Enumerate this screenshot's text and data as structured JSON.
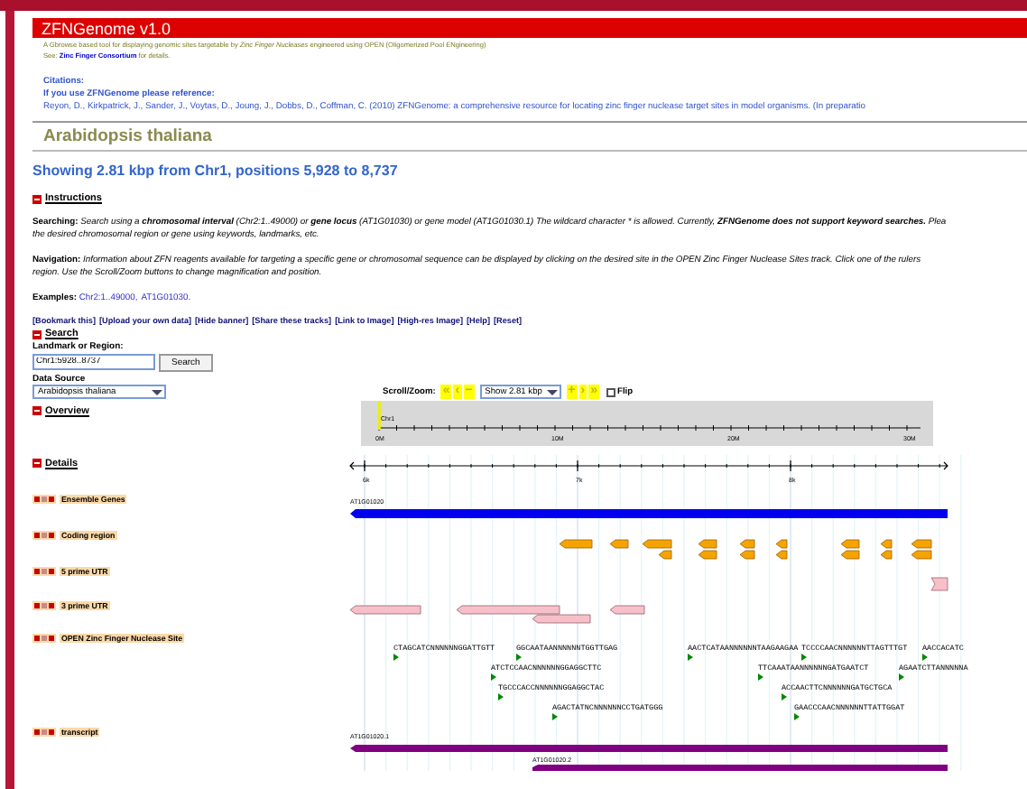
{
  "header": {
    "title": "ZFNGenome v1.0",
    "tagline": "A Gbrowse based tool for displaying genomic sites targetable by *Zinc Finger Nucleases* engineered using OPEN (Oligomerized Pool ENgineering)",
    "see_prefix": "See:",
    "see_link": "Zinc Finger Consortium",
    "see_suffix": "for details."
  },
  "citations": {
    "heading": "Citations:",
    "intro": "If you use ZFNGenome please reference:",
    "reference": "Reyon, D., Kirkpatrick, J., Sander, J., Voytas, D., Joung, J., Dobbs, D., Coffman, C. (2010) ZFNGenome: a comprehensive resource for locating zinc finger nuclease target sites in model organisms. (In preparatio"
  },
  "organism": "Arabidopsis thaliana",
  "showing": "Showing 2.81 kbp from Chr1, positions 5,928 to 8,737",
  "instructions": {
    "heading": "Instructions",
    "expanded": true,
    "paragraphs": [
      {
        "label": "Searching:",
        "segments": [
          {
            "text": "Search using a ",
            "bold": false
          },
          {
            "text": "chromosomal interval",
            "bold": true
          },
          {
            "text": " (Chr2:1..49000) or ",
            "bold": false
          },
          {
            "text": "gene locus",
            "bold": true
          },
          {
            "text": " (AT1G01030) or gene model (AT1G01030.1) The wildcard character * is allowed. Currently, ",
            "bold": false
          },
          {
            "text": "ZFNGenome does not support keyword searches.",
            "bold": true
          },
          {
            "text": " Plea\nthe desired chromosomal region or gene using keywords, landmarks, etc.",
            "bold": false
          }
        ]
      },
      {
        "label": "Navigation:",
        "segments": [
          {
            "text": "Information about ZFN reagents available for targeting a specific gene or chromosomal sequence can be displayed by clicking on the desired site in the OPEN Zinc Finger Nuclease Sites track. Click one of the rulers\nregion. Use the Scroll/Zoom buttons to change magnification and position.",
            "bold": false
          }
        ]
      }
    ],
    "examples_label": "Examples:",
    "examples": [
      "Chr2:1..49000,",
      "AT1G01030."
    ]
  },
  "links": [
    "[Bookmark this]",
    "[Upload your own data]",
    "[Hide banner]",
    "[Share these tracks]",
    "[Link to Image]",
    "[High-res Image]",
    "[Help]",
    "[Reset]"
  ],
  "search": {
    "heading": "Search",
    "expanded": true,
    "landmark_label": "Landmark or Region:",
    "landmark_value": "Chr1:5928..8737",
    "button": "Search",
    "source_label": "Data Source",
    "source_value": "Arabidopsis thaliana"
  },
  "scroll_zoom": {
    "label": "Scroll/Zoom:",
    "buttons_left": [
      "«",
      "‹",
      "−"
    ],
    "zoom_value": "Show 2.81 kbp",
    "buttons_right": [
      "+",
      "›",
      "»"
    ],
    "flip_label": "Flip",
    "flip_checked": false
  },
  "overview": {
    "heading": "Overview",
    "expanded": true,
    "chromosome": "Chr1",
    "ticks": [
      "0M",
      "10M",
      "20M",
      "30M"
    ]
  },
  "details": {
    "heading": "Details",
    "expanded": true,
    "ticks": [
      "6k",
      "7k",
      "8k"
    ]
  },
  "tracks": [
    {
      "kind": "ensembl",
      "label": "Ensemble Genes",
      "feature_labels": [
        "AT1G01020"
      ]
    },
    {
      "kind": "coding",
      "label": "Coding region"
    },
    {
      "kind": "utr5",
      "label": "5 prime UTR"
    },
    {
      "kind": "utr3",
      "label": "3 prime UTR"
    },
    {
      "kind": "zfn",
      "label": "OPEN Zinc Finger Nuclease Site",
      "sites": [
        "CTAGCATCNNNNNNGGATTGTT",
        "GGCAATAANNNNNNTGGTTGAG",
        "AACTCATAANNNNNNTAAGAAGAA",
        "TCCCCAACNNNNNNTTAGTTTGT",
        "AACCACATC",
        "ATCTCCAACNNNNNNGGAGGCTTC",
        "TTCAAATAANNNNNNGATGAATCT",
        "AGAATCTTANNNNNA",
        "TGCCCACCNNNNNNGGAGGCTAC",
        "ACCAACTTCNNNNNNGATGCTGCA",
        "AGACTATNCNNNNNNCCTGATGGG",
        "GAACCCAACNNNNNNTTATTGGAT"
      ]
    },
    {
      "kind": "transcript",
      "label": "transcript",
      "feature_labels": [
        "AT1G01020.1",
        "AT1G01020.2"
      ]
    }
  ]
}
